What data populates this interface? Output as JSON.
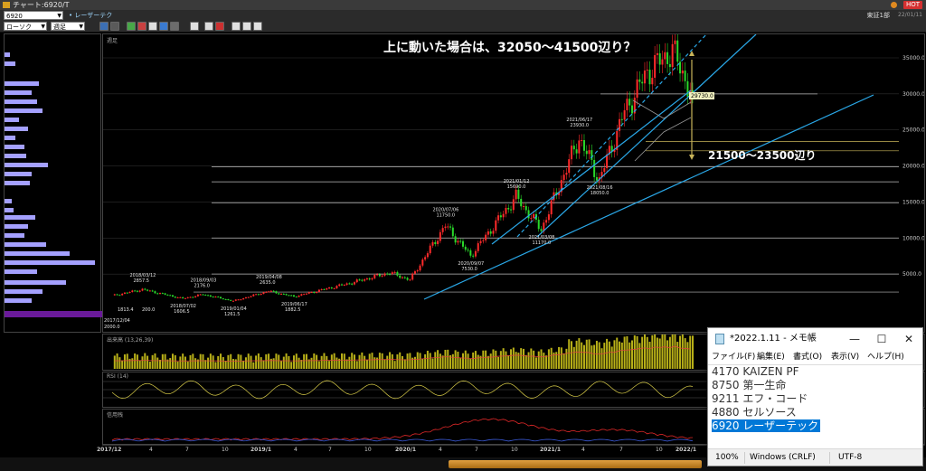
{
  "window": {
    "title": "チャート:6920/T",
    "hot_label": "HOT"
  },
  "toolbar": {
    "code_value": "6920",
    "stock_name": "レーザーテク",
    "chart_type": "ローソク",
    "period": "週足",
    "market": "東証1部",
    "date": "22/01/11"
  },
  "chart": {
    "panel_label": "週足",
    "price_labels": [
      "35000.0",
      "30000.0",
      "25000.0",
      "20000.0",
      "15000.0",
      "10000.0",
      "5000.0"
    ],
    "current_price": "29730.0",
    "annotation_top": "上に動いた場合は、32050～41500辺り？",
    "annotation_mid": "21500～23500辺り",
    "peaks": [
      {
        "date": "2018/03/12",
        "value": "2857.5"
      },
      {
        "date": "2018/09/03",
        "value": "2176.0"
      },
      {
        "date": "2019/04/08",
        "value": "2635.0"
      },
      {
        "date": "2020/07/06",
        "value": "11750.0"
      },
      {
        "date": "2021/01/12",
        "value": "15690.0"
      },
      {
        "date": "2021/06/17",
        "value": "23930.0"
      }
    ],
    "troughs": [
      {
        "date": "2018/07/02",
        "value": "1606.5"
      },
      {
        "date": "2019/01/04",
        "value": "1261.5"
      },
      {
        "date": "2019/06/17",
        "value": "1882.5"
      },
      {
        "date": "2020/09/07",
        "value": "7530.0"
      },
      {
        "date": "2021/03/08",
        "value": "11170.0"
      },
      {
        "date": "2021/08/16",
        "value": "18050.0"
      }
    ],
    "edge_low_date": "2017/12/04",
    "edge_low_value": "2000.0",
    "edge_left_value": "1813.4",
    "edge_left_value2": "200.0"
  },
  "volume": {
    "label": "出来高 (13,26,39)"
  },
  "rsi": {
    "label": "RSI (14)"
  },
  "margin": {
    "label": "信用残"
  },
  "xaxis": {
    "labels": [
      "2017/12",
      "4",
      "7",
      "10",
      "2019/1",
      "4",
      "7",
      "10",
      "2020/1",
      "4",
      "7",
      "10",
      "2021/1",
      "4",
      "7",
      "10",
      "2022/1"
    ]
  },
  "notepad": {
    "title": "*2022.1.11 - メモ帳",
    "minimize": "—",
    "maximize": "☐",
    "close": "✕",
    "menu": [
      "ファイル(F)",
      "編集(E)",
      "書式(O)",
      "表示(V)",
      "ヘルプ(H)"
    ],
    "lines": [
      "4170 KAIZEN PF",
      "8750 第一生命",
      "9211 エフ・コード",
      "4880 セルソース",
      "6920 レーザーテック"
    ],
    "status": {
      "zoom": "100%",
      "line_ending": "Windows (CRLF)",
      "encoding": "UTF-8"
    }
  }
}
